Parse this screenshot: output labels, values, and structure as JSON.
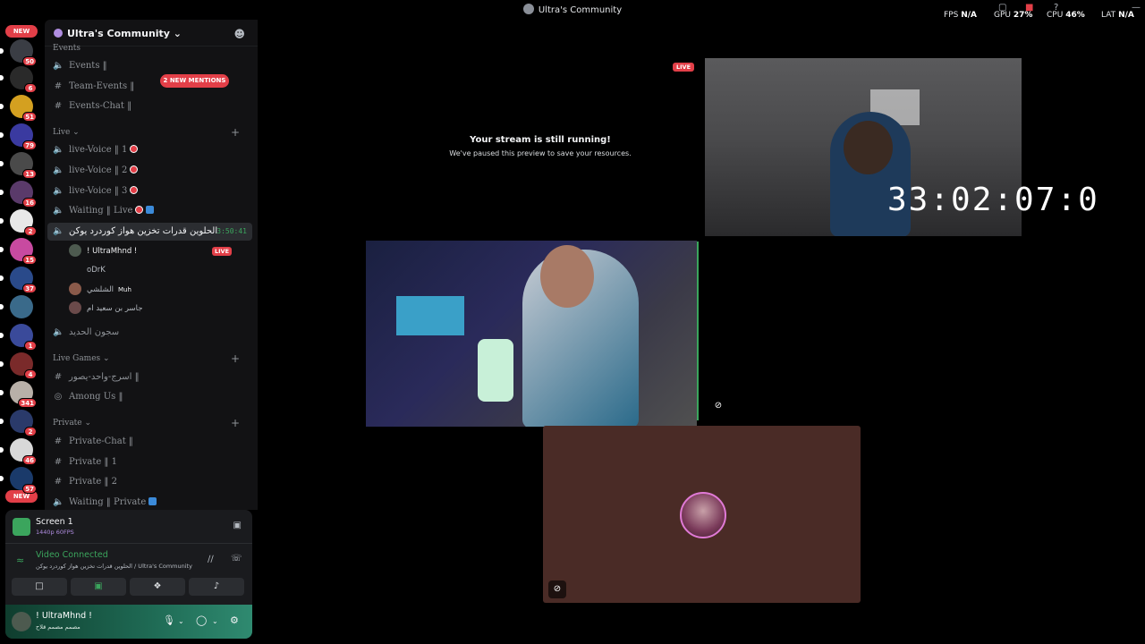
{
  "window": {
    "title": "Ultra's Community"
  },
  "perf": {
    "fps_label": "FPS",
    "fps_value": "N/A",
    "gpu_label": "GPU",
    "gpu_value": "27%",
    "cpu_label": "CPU",
    "cpu_value": "46%",
    "lat_label": "LAT",
    "lat_value": "N/A"
  },
  "rail": {
    "new_top": "NEW",
    "new_bottom": "NEW",
    "servers": [
      {
        "badge": "50"
      },
      {
        "badge": "6"
      },
      {
        "badge": "51"
      },
      {
        "badge": "79"
      },
      {
        "badge": "13"
      },
      {
        "badge": "16"
      },
      {
        "badge": "2"
      },
      {
        "badge": "15"
      },
      {
        "badge": "37"
      },
      {
        "badge": ""
      },
      {
        "badge": "1"
      },
      {
        "badge": "4"
      },
      {
        "badge": "341"
      },
      {
        "badge": "2"
      },
      {
        "badge": "46"
      },
      {
        "badge": "57"
      }
    ]
  },
  "sidebar": {
    "server_name": "Ultra's Community",
    "mentions": "2 NEW MENTIONS",
    "categories": {
      "events": "Events",
      "live": "Live",
      "live_games": "Live Games",
      "private": "Private"
    },
    "channels": {
      "events": "Events ‖",
      "team_events": "Team-Events ‖",
      "events_chat": "Events-Chat ‖",
      "live_voice_1": "live-Voice ‖ 1",
      "live_voice_2": "live-Voice ‖ 2",
      "live_voice_3": "live-Voice ‖ 3",
      "waiting_live": "Waiting ‖ Live",
      "active_voice": "الحلوين قدرات تخزين هواز كوردرد يوكن",
      "active_time": "3:50:41",
      "prison": "سجون الحديد",
      "game_chat": "اسرج-واحد-يصور ‖",
      "among_us": "Among Us ‖",
      "private_chat": "Private-Chat ‖",
      "private_1": "Private ‖ 1",
      "private_2": "Private ‖ 2",
      "waiting_private": "Waiting ‖ Private"
    },
    "users": [
      {
        "name": "! UltraMhnd !",
        "tag": "LIVE"
      },
      {
        "name": "oDrK",
        "tag": ""
      },
      {
        "name": "الشلشي",
        "tag": "Muh"
      },
      {
        "name": "جاسر بن سعيد ام",
        "tag": ""
      }
    ]
  },
  "panel": {
    "screen_title": "Screen 1",
    "screen_quality": "1440p 60FPS",
    "vc_status": "Video Connected",
    "vc_location": "الحلوين قدرات تخزين هواز كوردرد يوكن / Ultra's Community",
    "username": "! UltraMhnd !",
    "user_status": "مصمم مصمم قلاح"
  },
  "stage": {
    "paused_title": "Your stream is still running!",
    "paused_sub": "We've paused this preview to save your resources.",
    "live_badge": "LIVE",
    "timer": "33:02:07:0"
  },
  "colors": {
    "accent_red": "#e23f48",
    "connected_green": "#3ba55d",
    "background": "#000000"
  }
}
